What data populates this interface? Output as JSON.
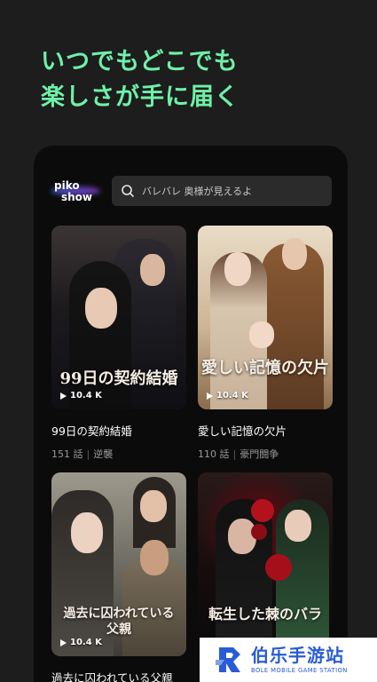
{
  "headline": {
    "line1": "いつでもどこでも",
    "line2": "楽しさが手に届く"
  },
  "app": {
    "logo_line1": "piko",
    "logo_line2": "show"
  },
  "search": {
    "placeholder": "バレバレ 奥様が見えるよ"
  },
  "dramas": [
    {
      "art_title": "99日の契約結婚",
      "views": "10.4 K",
      "title": "99日の契約結婚",
      "episodes": "151 話",
      "genre": "逆襲"
    },
    {
      "art_title": "愛しい記憶の欠片",
      "views": "10.4 K",
      "title": "愛しい記憶の欠片",
      "episodes": "110 話",
      "genre": "豪門闘争"
    },
    {
      "art_title": "過去に囚われている父親",
      "views": "10.4 K",
      "title": "過去に囚われている父親",
      "episodes": "",
      "genre": ""
    },
    {
      "art_title": "転生した棘のバラ",
      "views": "",
      "title": "",
      "episodes": "",
      "genre": ""
    }
  ],
  "watermark": {
    "main": "伯乐手游站",
    "sub": "BOLE MOBILE GAME STATION"
  },
  "colors": {
    "accent": "#6ff0a8",
    "background": "#1c1d1c",
    "phone": "#0b0b0b",
    "watermark": "#2a5bd7"
  }
}
